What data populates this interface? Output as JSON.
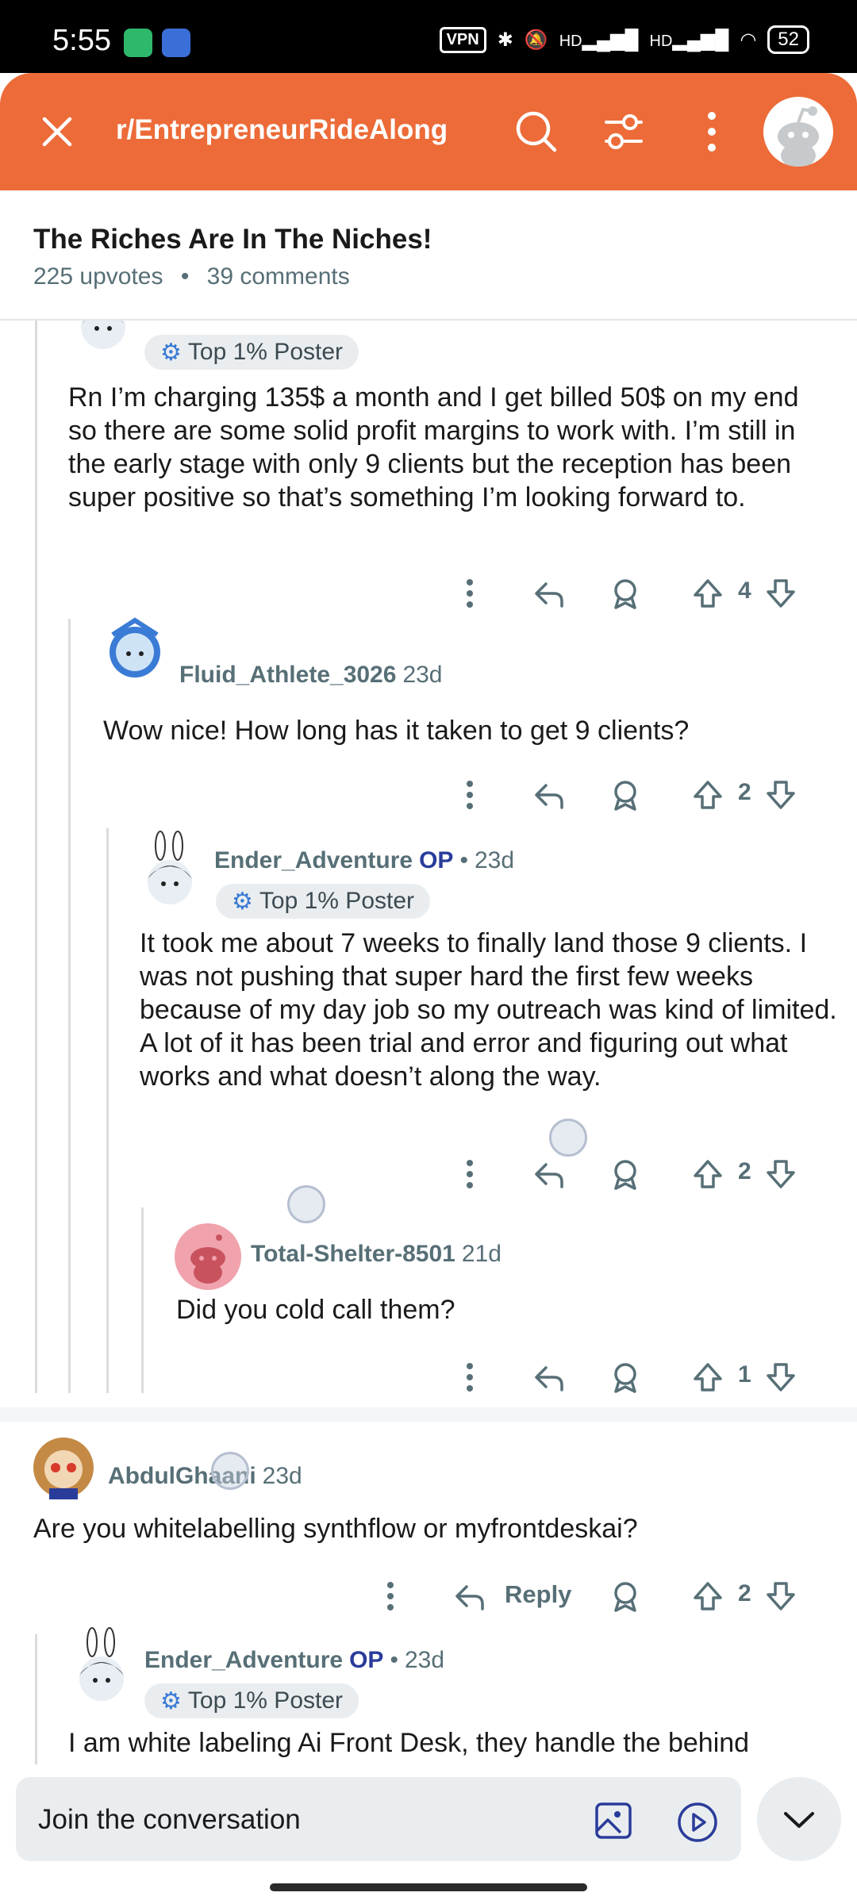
{
  "status_bar": {
    "time": "5:55",
    "vpn": "VPN",
    "network": "HD",
    "battery": "52"
  },
  "header": {
    "subreddit": "r/EntrepreneurRideAlong"
  },
  "post": {
    "title": "The Riches Are In The Niches!",
    "upvotes": "225 upvotes",
    "separator": "•",
    "comments": "39 comments"
  },
  "comments": [
    {
      "badge": "Top 1% Poster",
      "text": "Rn I’m charging 135$ a month and I get billed 50$ on my end so there are some solid profit margins to work with. I’m still in the early stage with only 9 clients but the reception has been super positive so that’s something I’m looking forward to.",
      "votes": "4"
    },
    {
      "author": "Fluid_Athlete_3026",
      "age": "23d",
      "text": "Wow nice! How long has it taken to get 9 clients?",
      "votes": "2"
    },
    {
      "author": "Ender_Adventure",
      "op": "OP",
      "dot": "•",
      "age": "23d",
      "badge": "Top 1% Poster",
      "text": "It took me about 7 weeks to finally land those 9 clients. I was not pushing that super hard the first few weeks because of my day job so my outreach was kind of limited. A lot of it has been trial and error and figuring out what works and what doesn’t along the way.",
      "votes": "2"
    },
    {
      "author": "Total-Shelter-8501",
      "age": "21d",
      "text": "Did you cold call them?",
      "votes": "1"
    },
    {
      "author": "AbdulGhaani",
      "age": "23d",
      "text": "Are you whitelabelling synthflow or myfrontdeskai?",
      "reply": "Reply",
      "votes": "2"
    },
    {
      "author": "Ender_Adventure",
      "op": "OP",
      "dot": "•",
      "age": "23d",
      "badge": "Top 1% Poster",
      "text": "I am white labeling Ai Front Desk, they handle the behind"
    }
  ],
  "composer": {
    "placeholder": "Join the conversation"
  },
  "colors": {
    "header": "#ec6b38",
    "op": "#2a3c9a",
    "meta": "#576f76"
  }
}
